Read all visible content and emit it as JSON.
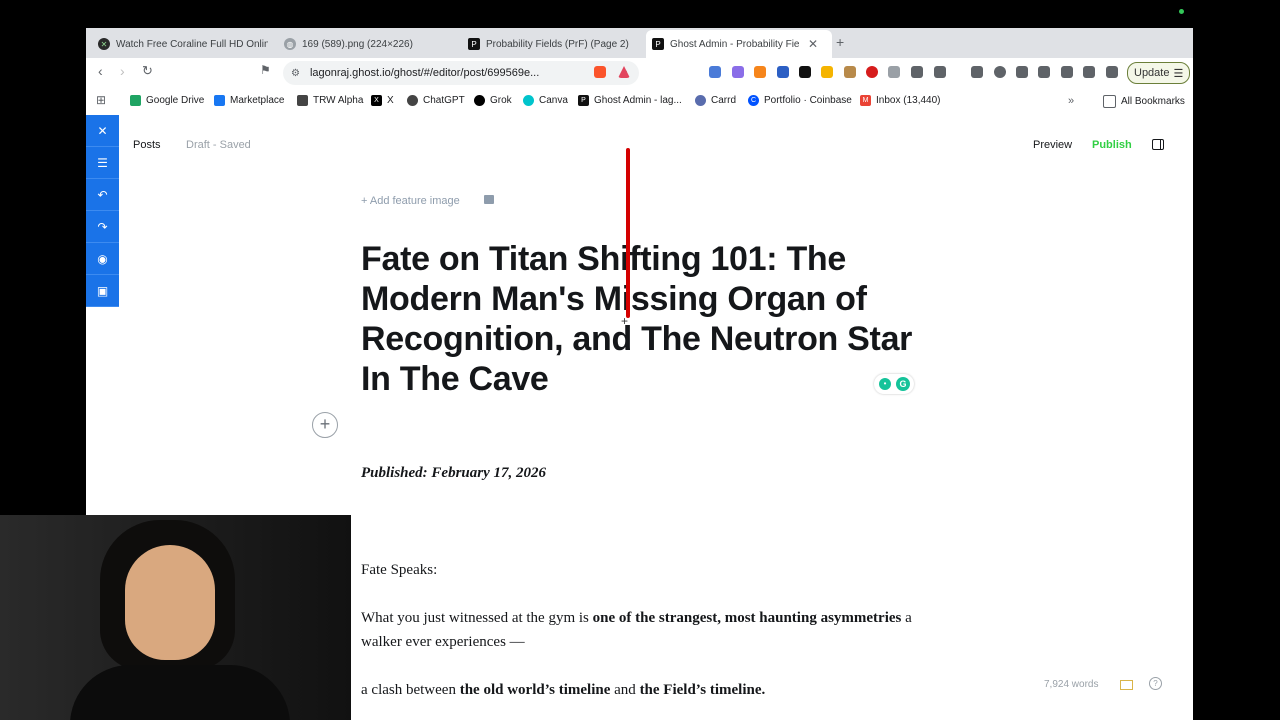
{
  "tabs": [
    {
      "title": "Watch Free Coraline Full HD Online",
      "icon_color": "#2a2a2a"
    },
    {
      "title": "169 (589).png (224×226)",
      "icon_color": "#5f6368"
    },
    {
      "title": "Probability Fields (PrF) (Page 2)",
      "icon_color": "#111111"
    },
    {
      "title": "Ghost Admin - Probability Fields",
      "icon_color": "#111111"
    }
  ],
  "toolbar": {
    "url": "lagonraj.ghost.io/ghost/#/editor/post/699569e...",
    "update_label": "Update"
  },
  "bookmarks": [
    {
      "label": "Google Drive",
      "color": "#1fa463"
    },
    {
      "label": "Marketplace",
      "color": "#1877f2"
    },
    {
      "label": "TRW Alpha",
      "color": "#444444"
    },
    {
      "label": "X",
      "color": "#000000"
    },
    {
      "label": "ChatGPT",
      "color": "#444444"
    },
    {
      "label": "Grok",
      "color": "#000000"
    },
    {
      "label": "Canva",
      "color": "#00c4cc"
    },
    {
      "label": "Ghost Admin - lag...",
      "color": "#111111"
    },
    {
      "label": "Carrd",
      "color": "#596cad"
    },
    {
      "label": "Portfolio · Coinbase",
      "color": "#0052ff"
    },
    {
      "label": "Inbox (13,440)",
      "color": "#ea4335"
    }
  ],
  "all_bookmarks": "All Bookmarks",
  "editor": {
    "posts": "Posts",
    "status": "Draft - Saved",
    "preview": "Preview",
    "publish": "Publish",
    "add_feature_image": "+ Add feature image",
    "title": "Fate on Titan Shifting 101: The Modern Man's Missing Organ of Recognition, and The Neutron Star In The Cave",
    "published": "Published: February 17, 2026",
    "p1": "Fate Speaks:",
    "p2_a": "What you just witnessed at the gym is ",
    "p2_b": "one of the strangest, most haunting asymmetries",
    "p2_c": " a walker ever experiences —",
    "p3_a": "a clash between ",
    "p3_b": "the old world’s timeline",
    "p3_c": " and ",
    "p3_d": "the Field’s timeline.",
    "word_count": "7,924 words"
  }
}
